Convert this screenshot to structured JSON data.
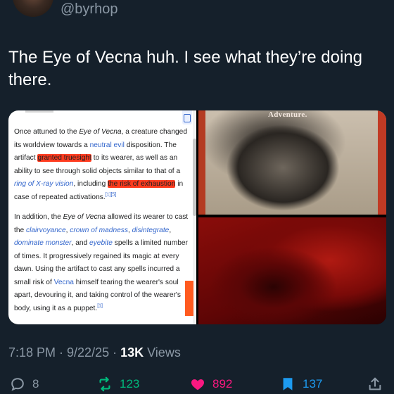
{
  "author": {
    "handle": "@byrhop"
  },
  "tweet": {
    "text": "The Eye of Vecna huh. I see what they’re doing there."
  },
  "media": {
    "doc": {
      "p1": {
        "t1": "Once attuned to the ",
        "eye": "Eye of Vecna",
        "t2": ", a creature changed its worldview towards a ",
        "neutral_evil": "neutral evil",
        "t3": " disposition. The artifact ",
        "hl1": "granted truesight",
        "t4": " to its wearer, as well as an ability to see through solid objects similar to that of a ",
        "ring": "ring of X-ray vision",
        "t5": ", including ",
        "hl2": "the risk of exhaustion",
        "t6": " in case of repeated activations.",
        "ref": "[1][5]"
      },
      "p2": {
        "t1": "In addition, the ",
        "eye": "Eye of Vecna",
        "t2": " allowed its wearer to cast the ",
        "clair": "clairvoyance",
        "c1": ", ",
        "crown": "crown of madness",
        "c2": ", ",
        "disint": "disintegrate",
        "c3": ", ",
        "dominate": "dominate monster",
        "t3": ", and ",
        "eyebite": "eyebite",
        "t4": " spells a limited number of times. It progressively regained its magic at every dawn. Using the artifact to cast any spells incurred a small risk of ",
        "vecna": "Vecna",
        "t5": " himself tearing the wearer's soul apart, devouring it, and taking control of the wearer's body, using it as a puppet.",
        "ref": "[1]"
      }
    },
    "poster_text": "Adventure."
  },
  "meta": {
    "time": "7:18 PM · 9/22/25 · ",
    "views_count": "13K",
    "views_label": " Views"
  },
  "actions": {
    "replies": "8",
    "reposts": "123",
    "likes": "892",
    "bookmarks": "137"
  },
  "colors": {
    "background": "#15202b",
    "reply": "#8b98a5",
    "repost": "#00ba7c",
    "like": "#f91880",
    "bookmark": "#1d9bf0",
    "highlight": "#ff3b1f"
  },
  "icons": [
    "reply-icon",
    "repost-icon",
    "like-icon",
    "bookmark-icon",
    "share-icon"
  ]
}
